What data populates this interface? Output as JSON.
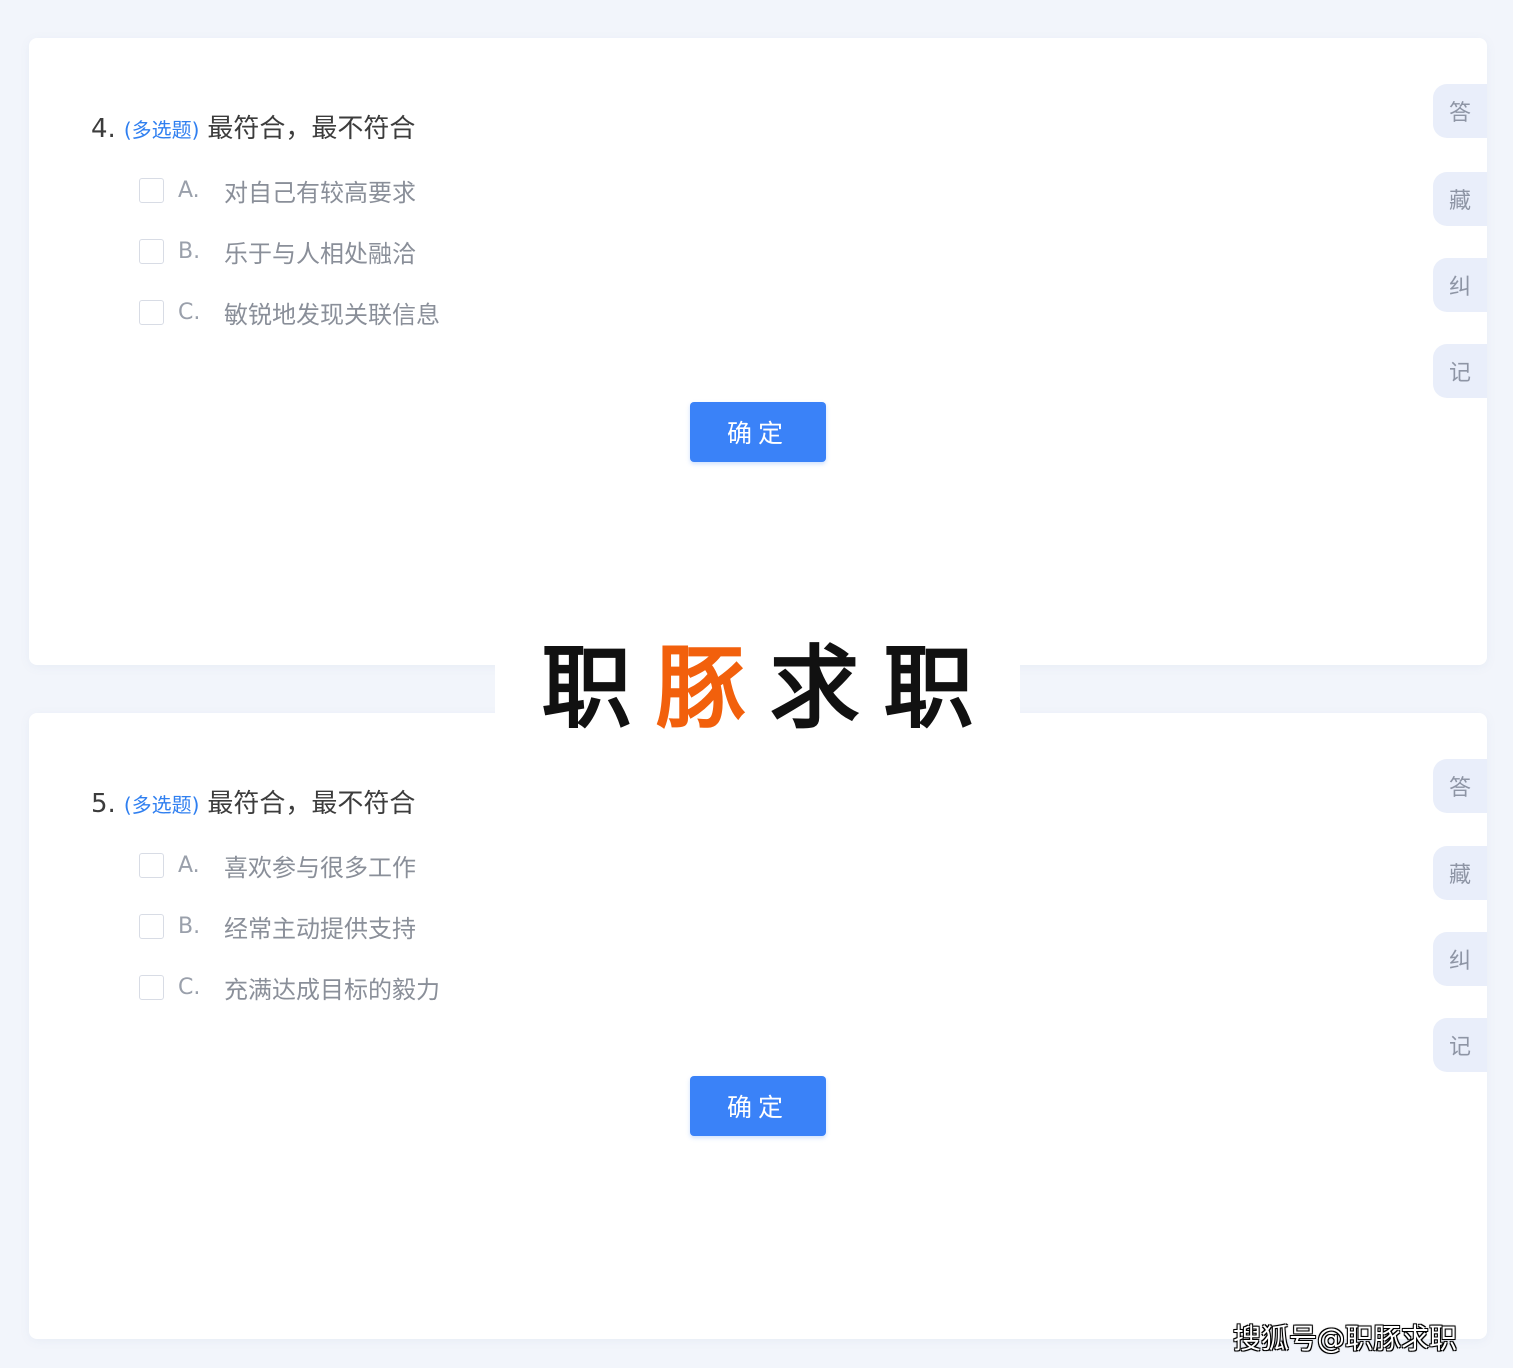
{
  "questions": [
    {
      "number": "4.",
      "type_label": "(多选题)",
      "title": "最符合，最不符合",
      "options": [
        {
          "letter": "A.",
          "text": "对自己有较高要求"
        },
        {
          "letter": "B.",
          "text": "乐于与人相处融洽"
        },
        {
          "letter": "C.",
          "text": "敏锐地发现关联信息"
        }
      ],
      "confirm_label": "确定",
      "side_tabs": [
        "答",
        "藏",
        "纠",
        "记"
      ]
    },
    {
      "number": "5.",
      "type_label": "(多选题)",
      "title": "最符合，最不符合",
      "options": [
        {
          "letter": "A.",
          "text": "喜欢参与很多工作"
        },
        {
          "letter": "B.",
          "text": "经常主动提供支持"
        },
        {
          "letter": "C.",
          "text": "充满达成目标的毅力"
        }
      ],
      "confirm_label": "确定",
      "side_tabs": [
        "答",
        "藏",
        "纠",
        "记"
      ]
    }
  ],
  "watermark": {
    "chars": [
      "职",
      "豚",
      "求",
      "职"
    ],
    "accent_color": "#f2600c"
  },
  "footer_credit": "搜狐号@职豚求职",
  "colors": {
    "accent": "#3a82f8",
    "question_type": "#2f7ff0",
    "background": "#f2f5fb",
    "side_tab": "#e9eefa"
  }
}
